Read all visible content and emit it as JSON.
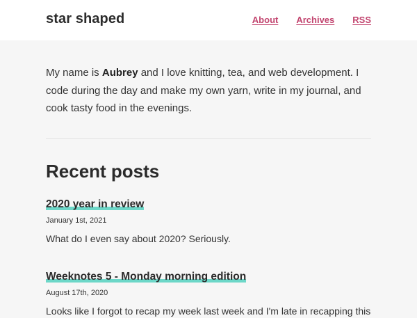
{
  "header": {
    "site_title": "star shaped",
    "nav": [
      "About",
      "Archives",
      "RSS"
    ]
  },
  "intro": {
    "pre": "My name is ",
    "name": "Aubrey",
    "post": " and I love knitting, tea, and web development. I code during the day and make my own yarn, write in my journal, and cook tasty food in the evenings."
  },
  "recent": {
    "heading": "Recent posts",
    "posts": [
      {
        "title": "2020 year in review",
        "date": "January 1st, 2021",
        "excerpt": "What do I even say about 2020? Seriously."
      },
      {
        "title": "Weeknotes 5 - Monday morning edition",
        "date": "August 17th, 2020",
        "excerpt": "Looks like I forgot to recap my week last week and I'm late in recapping this"
      }
    ]
  },
  "colors": {
    "link": "#c2456f",
    "highlight": "#6dd7c8"
  }
}
